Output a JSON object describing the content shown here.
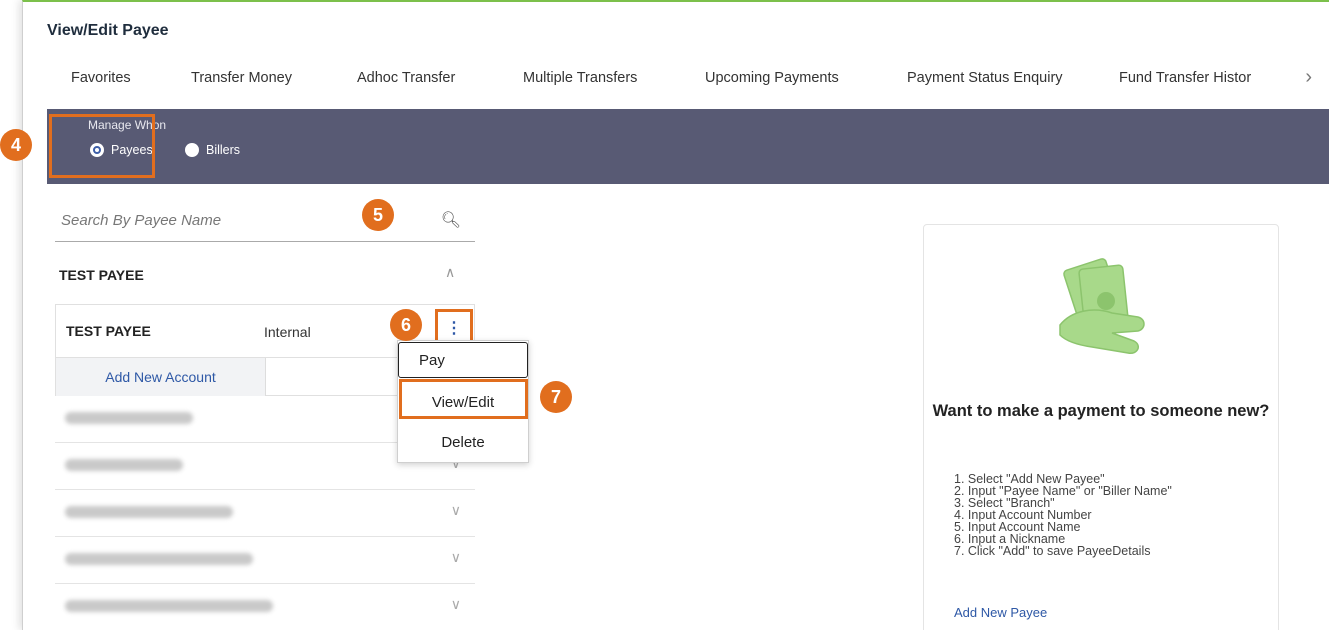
{
  "page": {
    "title": "View/Edit Payee"
  },
  "nav": {
    "items": [
      "Favorites",
      "Transfer Money",
      "Adhoc Transfer",
      "Multiple Transfers",
      "Upcoming Payments",
      "Payment Status Enquiry",
      "Fund Transfer Histor"
    ],
    "more_icon": "chevron-right-icon"
  },
  "manage": {
    "label": "Manage Whon",
    "options": [
      "Payees",
      "Billers"
    ],
    "selected": "Payees"
  },
  "search": {
    "placeholder": "Search By Payee Name",
    "icon": "search-icon"
  },
  "group": {
    "title": "TEST PAYEE"
  },
  "payee": {
    "name": "TEST PAYEE",
    "type": "Internal",
    "add_account_label": "Add New Account"
  },
  "menu": {
    "items": [
      "Pay",
      "View/Edit",
      "Delete"
    ]
  },
  "callouts": [
    "4",
    "5",
    "6",
    "7"
  ],
  "promo": {
    "title": "Want to make a payment to someone new?",
    "steps": [
      "1. Select \"Add New Payee\"",
      "2. Input \"Payee Name\" or \"Biller Name\"",
      "3. Select \"Branch\"",
      "4. Input Account Number",
      "5. Input Account Name",
      "6. Input a Nickname",
      "7. Click \"Add\" to save PayeeDetails"
    ],
    "add_payee_label": "Add New Payee",
    "illustration": "money-hand-icon"
  },
  "colors": {
    "accent": "#e16e1e",
    "band": "#585a74",
    "link": "#2e58a6",
    "illustration": "#a8d98a"
  }
}
